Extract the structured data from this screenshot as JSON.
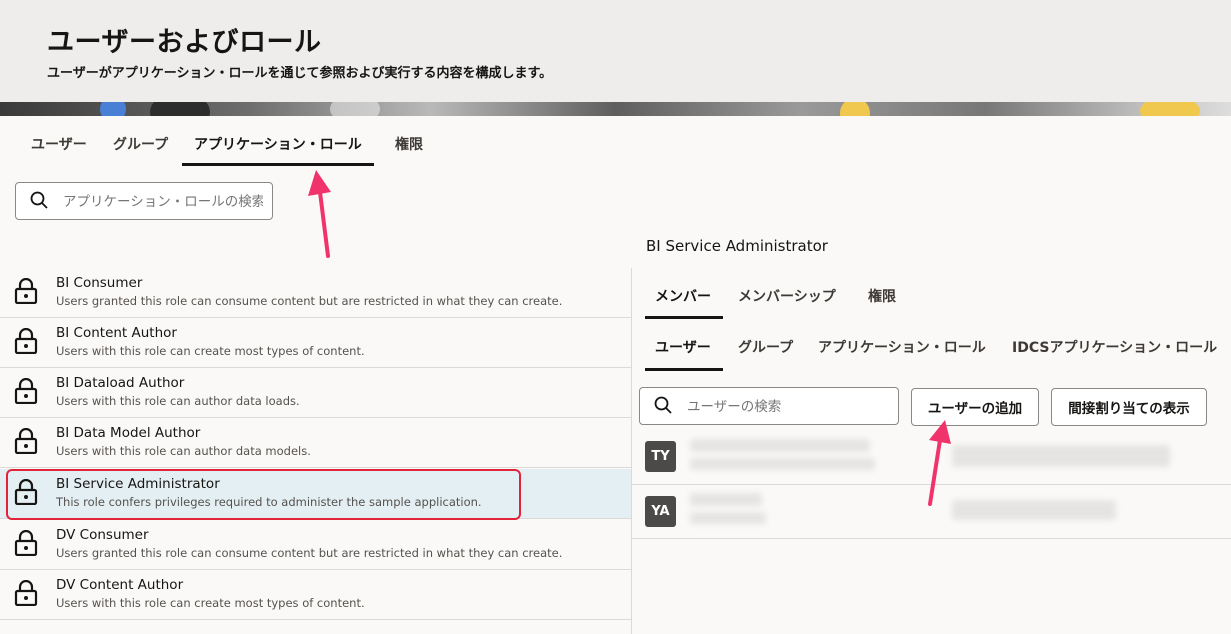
{
  "header": {
    "title": "ユーザーおよびロール",
    "subtitle": "ユーザーがアプリケーション・ロールを通じて参照および実行する内容を構成します。"
  },
  "tabs": [
    {
      "label": "ユーザー",
      "active": false
    },
    {
      "label": "グループ",
      "active": false
    },
    {
      "label": "アプリケーション・ロール",
      "active": true
    },
    {
      "label": "権限",
      "active": false
    }
  ],
  "search": {
    "placeholder": "アプリケーション・ロールの検索"
  },
  "roles": [
    {
      "name": "BI Consumer",
      "desc": "Users granted this role can consume content but are restricted in what they can create."
    },
    {
      "name": "BI Content Author",
      "desc": "Users with this role can create most types of content."
    },
    {
      "name": "BI Dataload Author",
      "desc": "Users with this role can author data loads."
    },
    {
      "name": "BI Data Model Author",
      "desc": "Users with this role can author data models."
    },
    {
      "name": "BI Service Administrator",
      "desc": "This role confers privileges required to administer the sample application.",
      "selected": true
    },
    {
      "name": "DV Consumer",
      "desc": "Users granted this role can consume content but are restricted in what they can create."
    },
    {
      "name": "DV Content Author",
      "desc": "Users with this role can create most types of content."
    }
  ],
  "detail": {
    "title": "BI Service Administrator",
    "tabs": [
      "メンバー",
      "メンバーシップ",
      "権限"
    ],
    "subtabs": [
      "ユーザー",
      "グループ",
      "アプリケーション・ロール",
      "IDCSアプリケーション・ロール"
    ],
    "user_search_placeholder": "ユーザーの検索",
    "add_user_button": "ユーザーの追加",
    "show_indirect_button": "間接割り当ての表示",
    "members": [
      {
        "initials": "TY"
      },
      {
        "initials": "YA"
      }
    ]
  },
  "colors": {
    "accent_arrow": "#f0336a",
    "highlight": "#e2243b",
    "avatar_bg": "#4b4a48",
    "selected_row": "#e4eff4"
  }
}
